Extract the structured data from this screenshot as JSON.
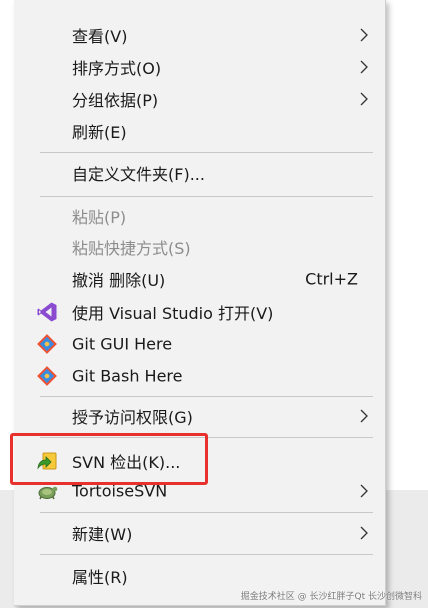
{
  "menu": {
    "view_label": "查看(V)",
    "sort_label": "排序方式(O)",
    "group_label": "分组依据(P)",
    "refresh_label": "刷新(E)",
    "customize_label": "自定义文件夹(F)...",
    "paste_label": "粘贴(P)",
    "paste_shortcut_label": "粘贴快捷方式(S)",
    "undo_delete_label": "撤消 删除(U)",
    "undo_delete_shortcut": "Ctrl+Z",
    "open_vs_label": "使用 Visual Studio 打开(V)",
    "git_gui_label": "Git GUI Here",
    "git_bash_label": "Git Bash Here",
    "grant_access_label": "授予访问权限(G)",
    "svn_checkout_label": "SVN 检出(K)...",
    "tortoisesvn_label": "TortoiseSVN",
    "new_label": "新建(W)",
    "properties_label": "属性(R)"
  },
  "watermark": "掘金技术社区 @ 长沙红胖子Qt 长沙创微智科"
}
